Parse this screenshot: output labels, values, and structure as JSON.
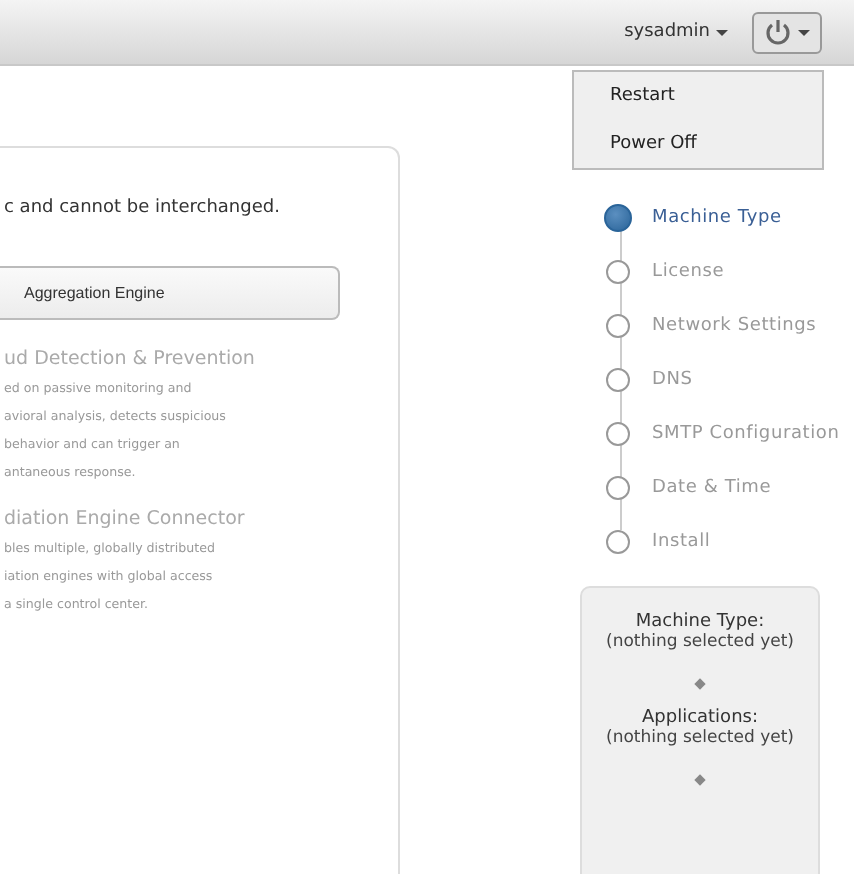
{
  "top_bar": {
    "user_menu": "sysadmin",
    "power_menu": {
      "open": true,
      "items": [
        "Restart",
        "Power Off"
      ]
    }
  },
  "left_panel": {
    "note": "c and cannot be interchanged.",
    "button": "Aggregation Engine",
    "features": [
      {
        "title": "ud Detection & Prevention",
        "lines": [
          "ed on passive monitoring and",
          "avioral analysis, detects suspicious",
          "behavior and can trigger an",
          "antaneous response."
        ]
      },
      {
        "title": "diation Engine Connector",
        "lines": [
          "bles multiple, globally distributed",
          "iation engines with global access",
          "a single control center."
        ]
      }
    ]
  },
  "steps": [
    {
      "label": "Machine Type",
      "selected": true
    },
    {
      "label": "License",
      "selected": false
    },
    {
      "label": "Network Settings",
      "selected": false
    },
    {
      "label": "DNS",
      "selected": false
    },
    {
      "label": "SMTP Configuration",
      "selected": false
    },
    {
      "label": "Date & Time",
      "selected": false
    },
    {
      "label": "Install",
      "selected": false
    }
  ],
  "summary": [
    {
      "heading": "Machine Type:",
      "value": "(nothing selected yet)"
    },
    {
      "heading": "Applications:",
      "value": "(nothing selected yet)"
    }
  ]
}
